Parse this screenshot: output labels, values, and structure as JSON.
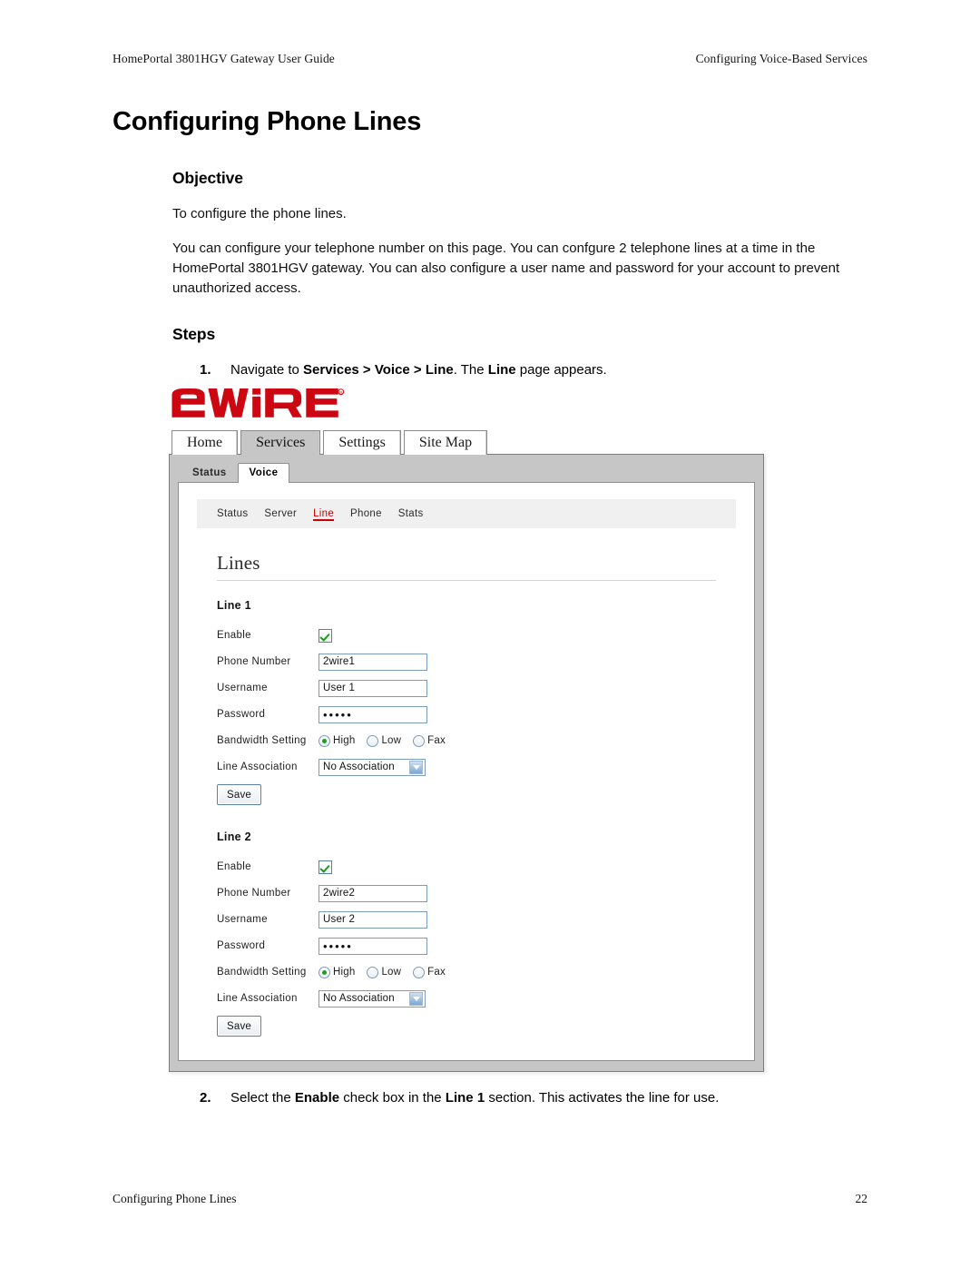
{
  "header": {
    "left": "HomePortal 3801HGV Gateway User Guide",
    "right": "Configuring Voice-Based Services"
  },
  "title": "Configuring Phone Lines",
  "objective": {
    "heading": "Objective",
    "para1": "To configure the phone lines.",
    "para2": "You can configure your telephone number on this page. You can confgure 2 telephone lines at a time in the HomePortal 3801HGV gateway. You can also configure a user name and password for your account to prevent unauthorized access."
  },
  "steps": {
    "heading": "Steps",
    "step1": {
      "number": "1.",
      "prefix": "Navigate to ",
      "bold1": "Services > Voice > Line",
      "mid": ". The ",
      "bold2": "Line",
      "suffix": " page appears."
    },
    "step2": {
      "number": "2.",
      "prefix": "Select the ",
      "bold1": "Enable",
      "mid": " check box in the ",
      "bold2": "Line 1",
      "suffix": " section. This activates the line for use."
    }
  },
  "screenshot": {
    "logo_text": "2WIRE",
    "logo_color": "#cc0711",
    "tabs": [
      {
        "label": "Home",
        "active": false
      },
      {
        "label": "Services",
        "active": true
      },
      {
        "label": "Settings",
        "active": false
      },
      {
        "label": "Site Map",
        "active": false
      }
    ],
    "subtabs": [
      {
        "label": "Status",
        "active": false
      },
      {
        "label": "Voice",
        "active": true
      }
    ],
    "navlinks": [
      {
        "label": "Status",
        "active": false
      },
      {
        "label": "Server",
        "active": false
      },
      {
        "label": "Line",
        "active": true
      },
      {
        "label": "Phone",
        "active": false
      },
      {
        "label": "Stats",
        "active": false
      }
    ],
    "active_link_color": "#cc0000",
    "page_heading": "Lines",
    "labels": {
      "enable": "Enable",
      "phone_number": "Phone Number",
      "username": "Username",
      "password": "Password",
      "bandwidth": "Bandwidth Setting",
      "line_association": "Line Association",
      "save": "Save"
    },
    "bandwidth_options": [
      "High",
      "Low",
      "Fax"
    ],
    "line_association_value": "No Association",
    "lines": [
      {
        "heading": "Line 1",
        "enabled": true,
        "phone_number": "2wire1",
        "username": "User 1",
        "password_mask": "•••••",
        "bandwidth_selected": "High",
        "line_association": "No Association"
      },
      {
        "heading": "Line 2",
        "enabled": true,
        "phone_number": "2wire2",
        "username": "User 2",
        "password_mask": "•••••",
        "bandwidth_selected": "High",
        "line_association": "No Association"
      }
    ]
  },
  "footer": {
    "left": "Configuring Phone Lines",
    "page_number": "22"
  }
}
